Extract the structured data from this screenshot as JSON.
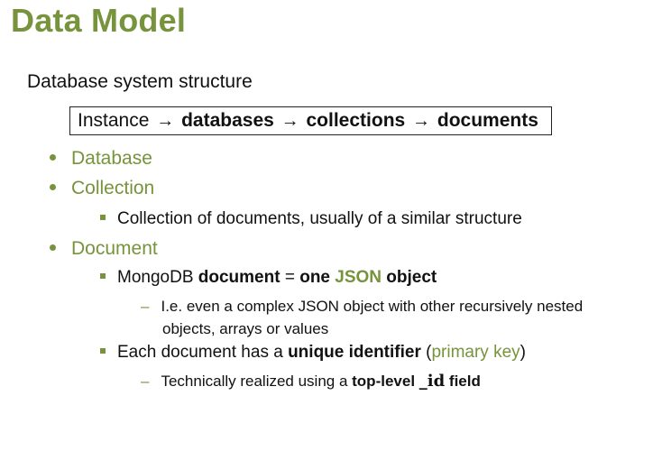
{
  "title": "Data Model",
  "subtitle": "Database system structure",
  "hierarchy": {
    "instance": "Instance",
    "arrow": "→",
    "databases": "databases",
    "collections": "collections",
    "documents": "documents"
  },
  "items": {
    "database": "Database",
    "collection": "Collection",
    "collection_desc": "Collection of documents, usually of a similar structure",
    "document": "Document",
    "doc_point1": {
      "prefix": "MongoDB ",
      "document": "document",
      "eq": " = ",
      "one": "one ",
      "json": "JSON",
      "object": " object"
    },
    "doc_sub1_line1": "I.e. even a complex JSON object with other recursively nested",
    "doc_sub1_line2": "objects, arrays or values",
    "doc_point2": {
      "prefix": "Each document has a ",
      "unique": "unique identifier",
      "open": " (",
      "primary_key": "primary key",
      "close": ")"
    },
    "doc_sub2": {
      "prefix": "Technically realized using a ",
      "top_level": "top-level ",
      "id": "_id",
      "field": " field"
    }
  },
  "colors": {
    "accent": "#77933c",
    "text": "#111111"
  }
}
